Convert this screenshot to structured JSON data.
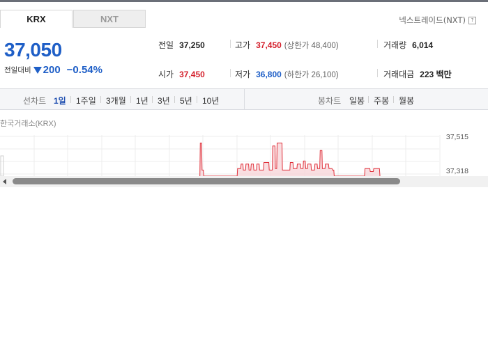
{
  "tabs": [
    {
      "label": "KRX",
      "active": true
    },
    {
      "label": "NXT",
      "active": false
    }
  ],
  "nxt_link": {
    "label": "넥스트레이드(NXT)",
    "help_icon": "?"
  },
  "price": {
    "current": "37,050",
    "change_label": "전일대비",
    "change_direction": "down",
    "change_value": "200",
    "change_percent": "−0.54%"
  },
  "stats": {
    "prev_close": {
      "label": "전일",
      "value": "37,250"
    },
    "high": {
      "label": "고가",
      "value": "37,450",
      "sub": "(상한가 48,400)"
    },
    "volume": {
      "label": "거래량",
      "value": "6,014"
    },
    "open": {
      "label": "시가",
      "value": "37,450"
    },
    "low": {
      "label": "저가",
      "value": "36,800",
      "sub": "(하한가 26,100)"
    },
    "trade_amount": {
      "label": "거래대금",
      "value": "223 백만"
    }
  },
  "line_chart_periods": {
    "label": "선차트",
    "items": [
      {
        "label": "1일",
        "active": true
      },
      {
        "label": "1주일",
        "active": false
      },
      {
        "label": "3개월",
        "active": false
      },
      {
        "label": "1년",
        "active": false
      },
      {
        "label": "3년",
        "active": false
      },
      {
        "label": "5년",
        "active": false
      },
      {
        "label": "10년",
        "active": false
      }
    ]
  },
  "candle_chart_periods": {
    "label": "봉차트",
    "items": [
      {
        "label": "일봉"
      },
      {
        "label": "주봉"
      },
      {
        "label": "월봉"
      }
    ]
  },
  "chart_source": "한국거래소(KRX)",
  "colors": {
    "up": "#d4202c",
    "down": "#1f5fc7",
    "accent": "#1f4fb0"
  },
  "chart_data": {
    "type": "line",
    "y_ticks": [
      "37,515",
      "37,318"
    ],
    "ylim": [
      37250,
      37560
    ],
    "grid": true,
    "series": [
      {
        "color": "#e0303a",
        "fill": "#f8d6da",
        "points": [
          [
            0.455,
            37250
          ],
          [
            0.456,
            37470
          ],
          [
            0.459,
            37470
          ],
          [
            0.46,
            37290
          ],
          [
            0.463,
            37290
          ],
          [
            0.464,
            37250
          ],
          [
            0.54,
            37250
          ],
          [
            0.541,
            37300
          ],
          [
            0.548,
            37300
          ],
          [
            0.549,
            37330
          ],
          [
            0.553,
            37330
          ],
          [
            0.554,
            37290
          ],
          [
            0.559,
            37290
          ],
          [
            0.56,
            37330
          ],
          [
            0.566,
            37330
          ],
          [
            0.567,
            37290
          ],
          [
            0.571,
            37290
          ],
          [
            0.572,
            37330
          ],
          [
            0.577,
            37330
          ],
          [
            0.578,
            37290
          ],
          [
            0.584,
            37290
          ],
          [
            0.585,
            37330
          ],
          [
            0.59,
            37330
          ],
          [
            0.591,
            37290
          ],
          [
            0.6,
            37290
          ],
          [
            0.601,
            37340
          ],
          [
            0.612,
            37340
          ],
          [
            0.613,
            37290
          ],
          [
            0.62,
            37290
          ],
          [
            0.621,
            37450
          ],
          [
            0.626,
            37450
          ],
          [
            0.627,
            37300
          ],
          [
            0.63,
            37300
          ],
          [
            0.631,
            37470
          ],
          [
            0.636,
            37470
          ],
          [
            0.637,
            37470
          ],
          [
            0.642,
            37470
          ],
          [
            0.643,
            37290
          ],
          [
            0.66,
            37290
          ],
          [
            0.661,
            37340
          ],
          [
            0.667,
            37340
          ],
          [
            0.668,
            37300
          ],
          [
            0.676,
            37300
          ],
          [
            0.677,
            37330
          ],
          [
            0.684,
            37330
          ],
          [
            0.685,
            37300
          ],
          [
            0.69,
            37300
          ],
          [
            0.691,
            37350
          ],
          [
            0.695,
            37350
          ],
          [
            0.696,
            37300
          ],
          [
            0.7,
            37300
          ],
          [
            0.701,
            37330
          ],
          [
            0.708,
            37330
          ],
          [
            0.709,
            37290
          ],
          [
            0.716,
            37290
          ],
          [
            0.717,
            37330
          ],
          [
            0.722,
            37330
          ],
          [
            0.723,
            37300
          ],
          [
            0.728,
            37300
          ],
          [
            0.729,
            37420
          ],
          [
            0.733,
            37420
          ],
          [
            0.734,
            37300
          ],
          [
            0.74,
            37300
          ],
          [
            0.741,
            37330
          ],
          [
            0.748,
            37330
          ],
          [
            0.749,
            37300
          ],
          [
            0.756,
            37300
          ],
          [
            0.757,
            37290
          ],
          [
            0.76,
            37290
          ],
          [
            0.761,
            37250
          ],
          [
            0.83,
            37250
          ],
          [
            0.831,
            37300
          ],
          [
            0.842,
            37300
          ],
          [
            0.843,
            37280
          ],
          [
            0.85,
            37280
          ],
          [
            0.851,
            37300
          ],
          [
            0.864,
            37300
          ],
          [
            0.865,
            37250
          ]
        ]
      }
    ]
  }
}
